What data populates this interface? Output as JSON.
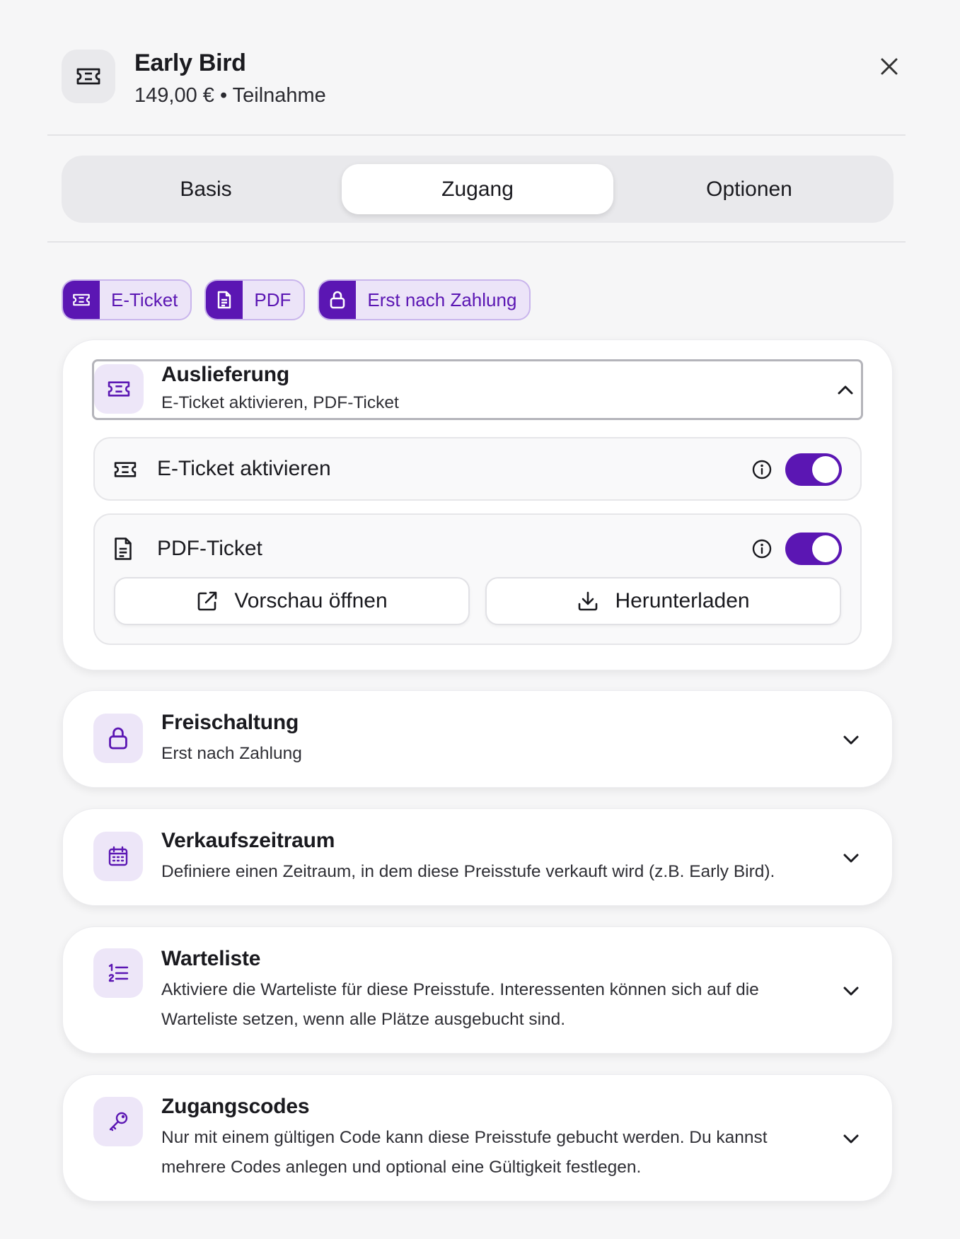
{
  "header": {
    "title": "Early Bird",
    "subtitle": "149,00 € • Teilnahme",
    "icon": "ticket-icon",
    "close_icon": "close-icon"
  },
  "tabs": [
    {
      "label": "Basis",
      "active": false
    },
    {
      "label": "Zugang",
      "active": true
    },
    {
      "label": "Optionen",
      "active": false
    }
  ],
  "chips": [
    {
      "label": "E-Ticket",
      "icon": "ticket-icon"
    },
    {
      "label": "PDF",
      "icon": "document-icon"
    },
    {
      "label": "Erst nach Zahlung",
      "icon": "lock-icon"
    }
  ],
  "delivery": {
    "title": "Auslieferung",
    "description": "E-Ticket aktivieren, PDF-Ticket",
    "expanded": true,
    "eticket": {
      "label": "E-Ticket aktivieren",
      "enabled": true
    },
    "pdf": {
      "label": "PDF-Ticket",
      "enabled": true,
      "preview_label": "Vorschau öffnen",
      "download_label": "Herunterladen"
    }
  },
  "sections": [
    {
      "title": "Freischaltung",
      "description": "Erst nach Zahlung",
      "icon": "lock-icon"
    },
    {
      "title": "Verkaufszeitraum",
      "description": "Definiere einen Zeitraum, in dem diese Preisstufe verkauft wird (z.B. Early Bird).",
      "icon": "calendar-icon"
    },
    {
      "title": "Warteliste",
      "description": "Aktiviere die Warteliste für diese Preisstufe. Interessenten können sich auf die Warteliste setzen, wenn alle Plätze ausgebucht sind.",
      "icon": "numbered-list-icon"
    },
    {
      "title": "Zugangscodes",
      "description": "Nur mit einem gültigen Code kann diese Preisstufe gebucht werden. Du kannst mehrere Codes anlegen und optional eine Gültigkeit festlegen.",
      "icon": "key-icon"
    }
  ],
  "colors": {
    "accent": "#5b16b3",
    "accent_soft": "#ece4f8",
    "background": "#f6f6f7"
  }
}
